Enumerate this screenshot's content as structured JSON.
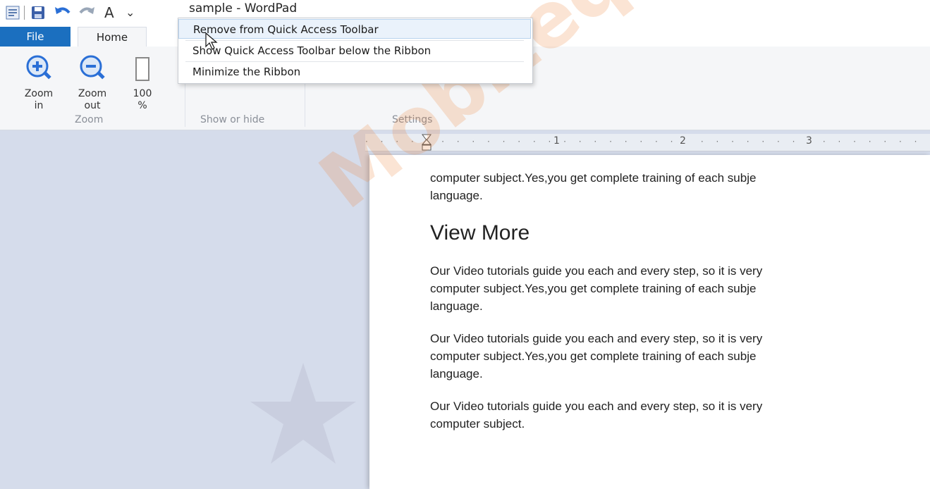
{
  "window": {
    "title": "sample - WordPad"
  },
  "qat": {
    "app_icon": "wordpad-app-icon",
    "save_icon": "save-icon",
    "undo_icon": "undo-icon",
    "redo_icon": "redo-icon",
    "font_icon_label": "A",
    "customize_icon": "customize-qat-icon"
  },
  "tabs": [
    {
      "label": "File"
    },
    {
      "label": "Home"
    }
  ],
  "ribbon": {
    "zoom_group": {
      "label": "Zoom",
      "buttons": [
        {
          "line1": "Zoom",
          "line2": "in",
          "icon": "zoom-in-icon"
        },
        {
          "line1": "Zoom",
          "line2": "out",
          "icon": "zoom-out-icon"
        },
        {
          "line1": "100",
          "line2": "%",
          "icon": "zoom-100-icon"
        }
      ]
    },
    "show_hide_group": {
      "label": "Show or hide"
    },
    "settings_group": {
      "label": "Settings"
    }
  },
  "context_menu": {
    "items": [
      {
        "label": "Remove from Quick Access Toolbar",
        "highlighted": true
      },
      {
        "label": "Show Quick Access Toolbar below the Ribbon",
        "highlighted": false
      },
      {
        "label": "Minimize the Ribbon",
        "highlighted": false
      }
    ]
  },
  "ruler": {
    "marks": [
      "1",
      "2",
      "3"
    ]
  },
  "document": {
    "line1": "computer subject.Yes,you get complete training of each subje",
    "line2": "language.",
    "heading": "View More",
    "para1": [
      "Our Video tutorials guide you each and every step, so it is very",
      "computer subject.Yes,you get complete training of each subje",
      "language."
    ],
    "para2": [
      "Our Video tutorials guide you each and every step, so it is very",
      "computer subject.Yes,you get complete training of each subje",
      "language."
    ],
    "para3": [
      "Our Video tutorials guide you each and every step, so it is very",
      "computer subject."
    ]
  },
  "watermark": {
    "text": "Mobiteq Aca"
  },
  "colors": {
    "file_tab": "#1b6fbf",
    "menu_highlight": "#eaf2fb",
    "workspace": "#d5dceb"
  }
}
